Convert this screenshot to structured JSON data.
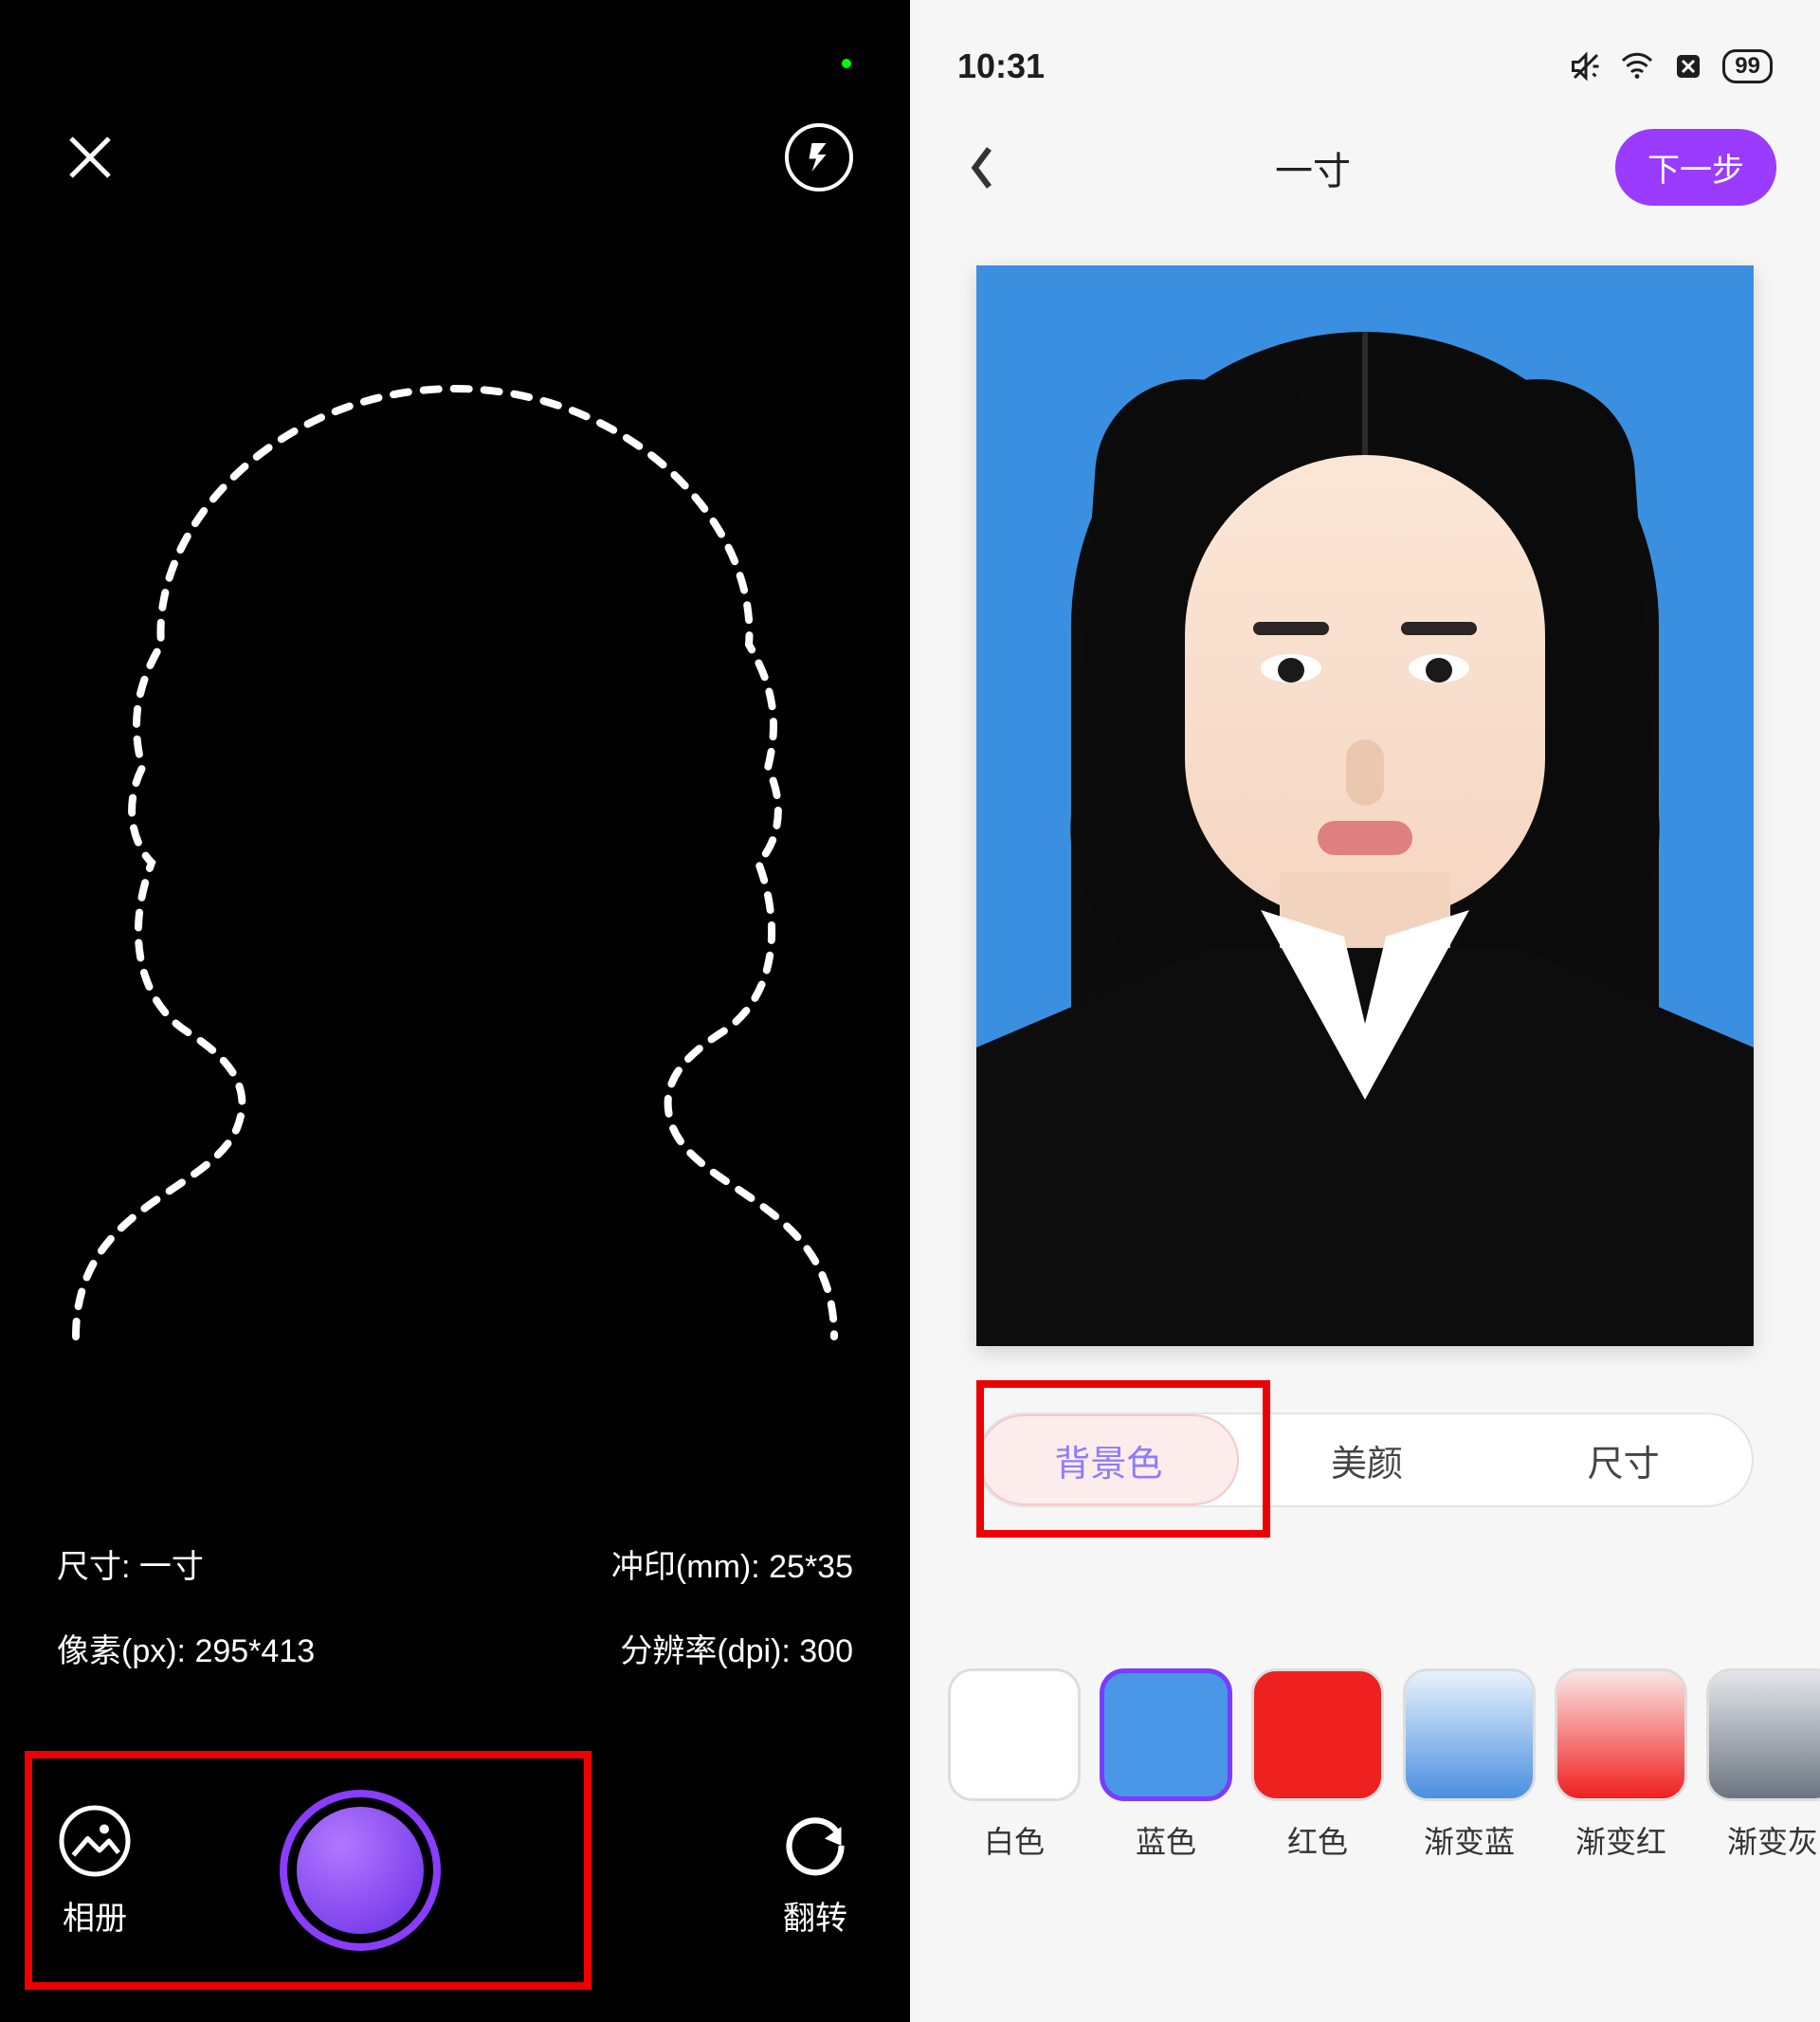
{
  "left": {
    "size_label": "尺寸:",
    "size_value": "一寸",
    "print_label": "冲印(mm):",
    "print_value": "25*35",
    "pixel_label": "像素(px):",
    "pixel_value": "295*413",
    "dpi_label": "分辨率(dpi):",
    "dpi_value": "300",
    "album_label": "相册",
    "flip_label": "翻转"
  },
  "right": {
    "status_time": "10:31",
    "status_battery": "99",
    "title": "一寸",
    "next_label": "下一步",
    "tabs": {
      "background": "背景色",
      "beauty": "美颜",
      "size": "尺寸"
    },
    "swatches": {
      "white": "白色",
      "blue": "蓝色",
      "red": "红色",
      "grad_blue": "渐变蓝",
      "grad_red": "渐变红",
      "grad_gray": "渐变灰"
    }
  }
}
